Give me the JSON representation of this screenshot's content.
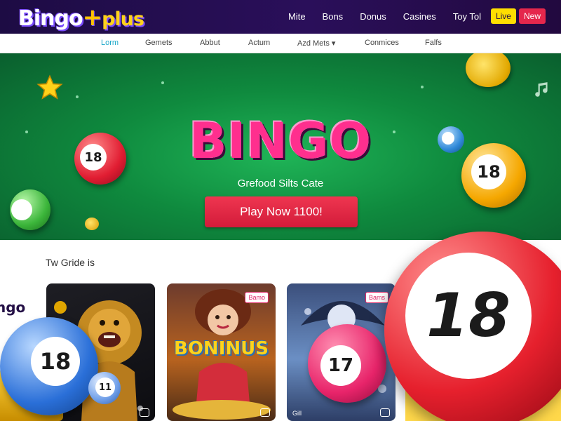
{
  "brand": {
    "name_part1": "Bingo",
    "name_plus": "+",
    "name_part2": "plus"
  },
  "top_nav": {
    "links": [
      "Mite",
      "Bons",
      "Donus",
      "Casines",
      "Toy Tol"
    ],
    "live_button": "Live",
    "new_button": "New"
  },
  "sub_nav": {
    "items": [
      "Lorm",
      "Gemets",
      "Abbut",
      "Actum",
      "Azd Mets ▾",
      "Conmices",
      "Falfs"
    ],
    "active_index": 0
  },
  "hero": {
    "title": "BINGO",
    "subtitle": "Grefood Silts Cate",
    "cta_label": "Play Now 1100!"
  },
  "balls": {
    "hero_left": "18",
    "hero_right": "18",
    "bottom_left": "18",
    "card_ball": "17",
    "big_right": "18",
    "small_card": "11"
  },
  "games_section": {
    "title": "Tw Gride is",
    "side_logo": "ngo",
    "cards": [
      {
        "name": "lion-game",
        "badge": "",
        "footer": ""
      },
      {
        "name": "boninus-game",
        "badge": "Bamo",
        "footer": "",
        "art_title": "BONINUS"
      },
      {
        "name": "bingo-ball-game",
        "badge": "Bams",
        "footer": "Gill"
      }
    ]
  },
  "colors": {
    "header_bg": "#22093f",
    "accent_pink": "#ff2f8e",
    "cta_red": "#e5274c",
    "live_yellow": "#ffde00",
    "hero_green": "#1fb457",
    "subnav_active": "#19a7c8"
  }
}
